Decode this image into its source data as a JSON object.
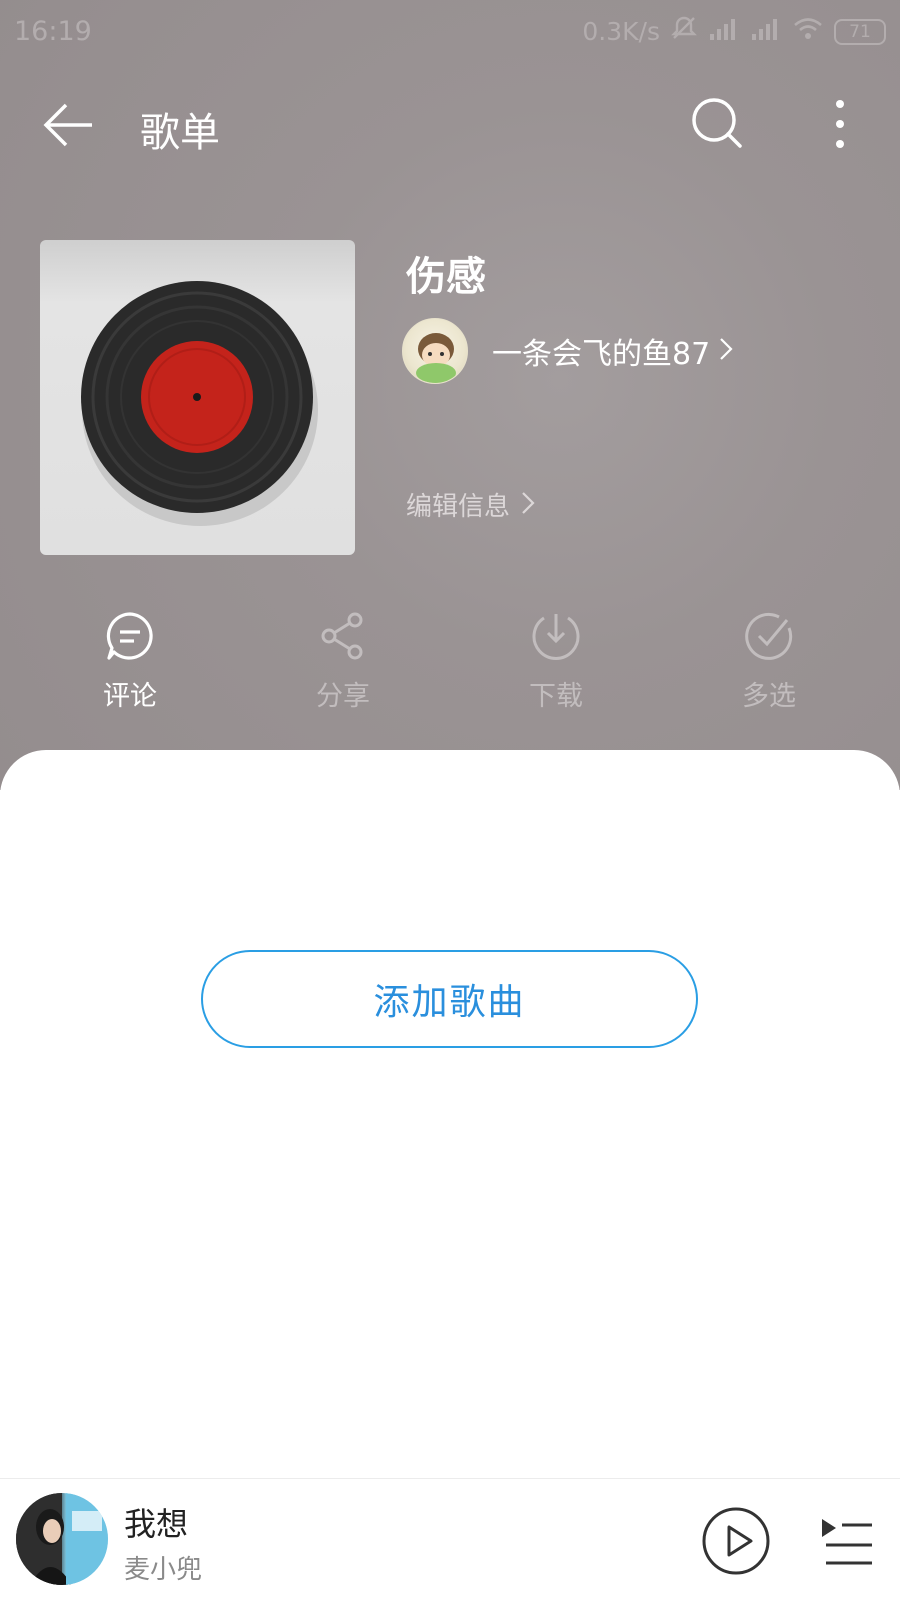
{
  "status_bar": {
    "time": "16:19",
    "network_speed": "0.3K/s",
    "battery": "71",
    "icons": [
      "mute-icon",
      "hd-signal-icon",
      "signal-icon",
      "wifi-icon",
      "battery-icon"
    ]
  },
  "header": {
    "title": "歌单",
    "icons": [
      "back-arrow-icon",
      "search-icon",
      "more-vertical-icon"
    ]
  },
  "playlist": {
    "name": "伤感",
    "creator": "一条会飞的鱼87",
    "edit_label": "编辑信息",
    "cover": "vinyl-record-image"
  },
  "actions": [
    {
      "label": "评论",
      "icon": "comment-icon",
      "enabled": true
    },
    {
      "label": "分享",
      "icon": "share-icon",
      "enabled": false
    },
    {
      "label": "下载",
      "icon": "download-icon",
      "enabled": false
    },
    {
      "label": "多选",
      "icon": "check-icon",
      "enabled": false
    }
  ],
  "content": {
    "add_song_label": "添加歌曲"
  },
  "mini_player": {
    "song_title": "我想",
    "artist": "麦小兜",
    "icons": [
      "play-icon",
      "playlist-icon"
    ]
  },
  "colors": {
    "header_bg": "#9a9394",
    "accent": "#2a9ee4",
    "disabled_text": "#c2bdbe"
  }
}
